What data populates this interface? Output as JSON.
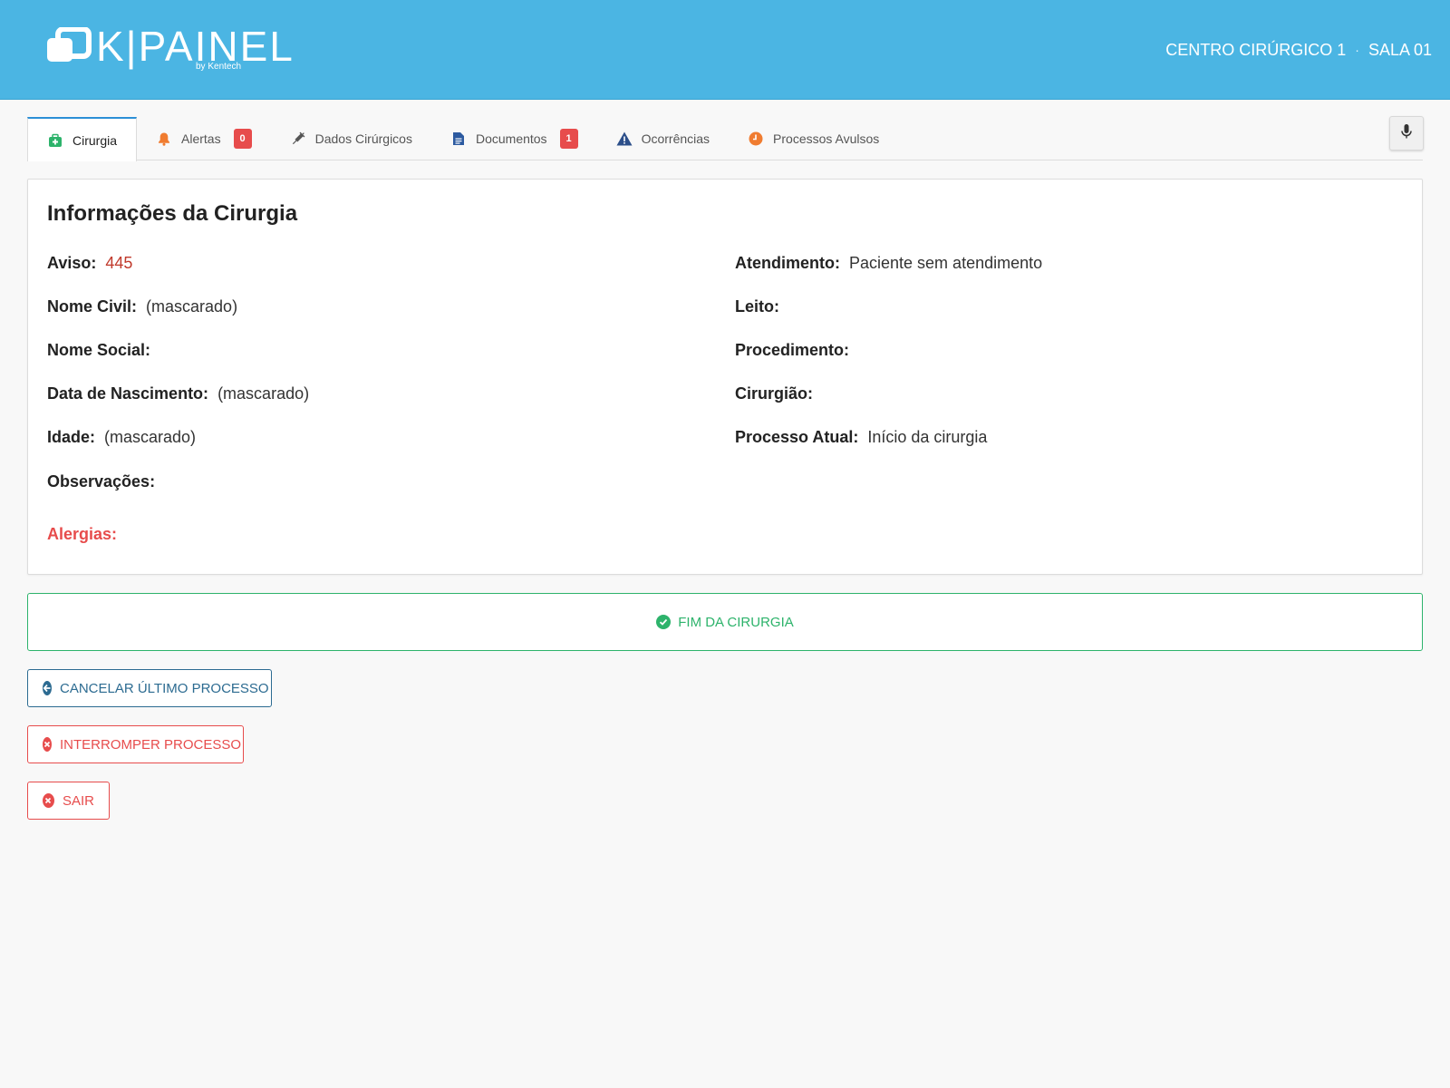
{
  "header": {
    "logo_text": "K|PAINEL",
    "logo_sub": "by Kentech",
    "unit": "CENTRO CIRÚRGICO 1",
    "separator": "·",
    "room": "SALA 01"
  },
  "tabs": [
    {
      "label": "Cirurgia",
      "icon": "medical-kit-icon",
      "active": true
    },
    {
      "label": "Alertas",
      "icon": "bell-icon",
      "badge": "0"
    },
    {
      "label": "Dados Cirúrgicos",
      "icon": "syringe-icon"
    },
    {
      "label": "Documentos",
      "icon": "document-icon",
      "badge": "1"
    },
    {
      "label": "Ocorrências",
      "icon": "warning-icon"
    },
    {
      "label": "Processos Avulsos",
      "icon": "clock-icon"
    }
  ],
  "card": {
    "title": "Informações da Cirurgia",
    "left": [
      {
        "label": "Aviso:",
        "value": "445"
      },
      {
        "label": "Nome Civil:",
        "value": "(mascarado)"
      },
      {
        "label": "Nome Social:",
        "value": ""
      },
      {
        "label": "Data de Nascimento:",
        "value": "(mascarado)"
      },
      {
        "label": "Idade:",
        "value": "(mascarado)"
      },
      {
        "label": "Observações:",
        "value": ""
      }
    ],
    "right": [
      {
        "label": "Atendimento:",
        "value": "Paciente sem atendimento"
      },
      {
        "label": "Leito:",
        "value": ""
      },
      {
        "label": "Procedimento:",
        "value": ""
      },
      {
        "label": "Cirurgião:",
        "value": ""
      },
      {
        "label": "Processo Atual:",
        "value": "Início da cirurgia"
      }
    ],
    "allergies_label": "Alergias:"
  },
  "actions": {
    "finish": "FIM DA CIRURGIA",
    "cancel_last": "CANCELAR ÚLTIMO PROCESSO",
    "interrupt": "INTERROMPER PROCESSO",
    "exit": "SAIR"
  },
  "colors": {
    "header_bg": "#4bb5e3",
    "success": "#2db36b",
    "danger": "#e74c4c",
    "primary_outline": "#2c6b91",
    "aviso_value": "#c0392b"
  }
}
